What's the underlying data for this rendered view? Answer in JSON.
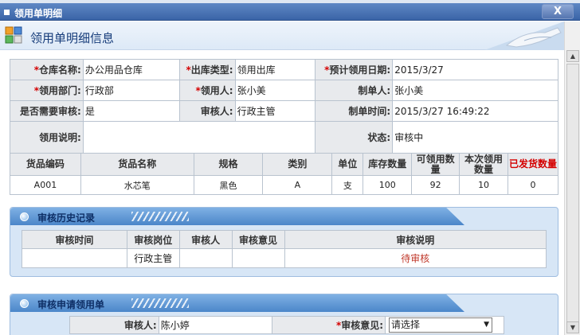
{
  "dialog": {
    "title": "领用单明细",
    "close_label": "X",
    "header_title": "领用单明细信息"
  },
  "info": {
    "warehouse_label": "仓库名称:",
    "warehouse_value": "办公用品仓库",
    "outtype_label": "出库类型:",
    "outtype_value": "领用出库",
    "plan_date_label": "预计领用日期:",
    "plan_date_value": "2015/3/27",
    "dept_label": "领用部门:",
    "dept_value": "行政部",
    "receiver_label": "领用人:",
    "receiver_value": "张小美",
    "creator_label": "制单人:",
    "creator_value": "张小美",
    "need_audit_label": "是否需要审核:",
    "need_audit_value": "是",
    "auditor_label": "审核人:",
    "auditor_value": "行政主管",
    "create_time_label": "制单时间:",
    "create_time_value": "2015/3/27 16:49:22",
    "remark_label": "领用说明:",
    "remark_value": "",
    "status_label": "状态:",
    "status_value": "审核中"
  },
  "goods": {
    "headers": [
      "货品编码",
      "货品名称",
      "规格",
      "类别",
      "单位",
      "库存数量",
      "可领用数量",
      "本次领用数量",
      "已发货数量"
    ],
    "rows": [
      [
        "A001",
        "水芯笔",
        "黑色",
        "A",
        "支",
        "100",
        "92",
        "10",
        "0"
      ]
    ]
  },
  "history": {
    "title": "审核历史记录",
    "headers": [
      "审核时间",
      "审核岗位",
      "审核人",
      "审核意见",
      "审核说明"
    ],
    "rows": [
      [
        "",
        "行政主管",
        "",
        "",
        "待审核"
      ]
    ]
  },
  "apply": {
    "title": "审核申请领用单",
    "auditor_label": "审核人:",
    "auditor_value": "陈小婷",
    "opinion_label": "审核意见:",
    "opinion_value": "请选择"
  },
  "colors": {
    "accent": "#3a64a7",
    "required": "#d40000",
    "panel_bg": "#d7e6f6"
  }
}
